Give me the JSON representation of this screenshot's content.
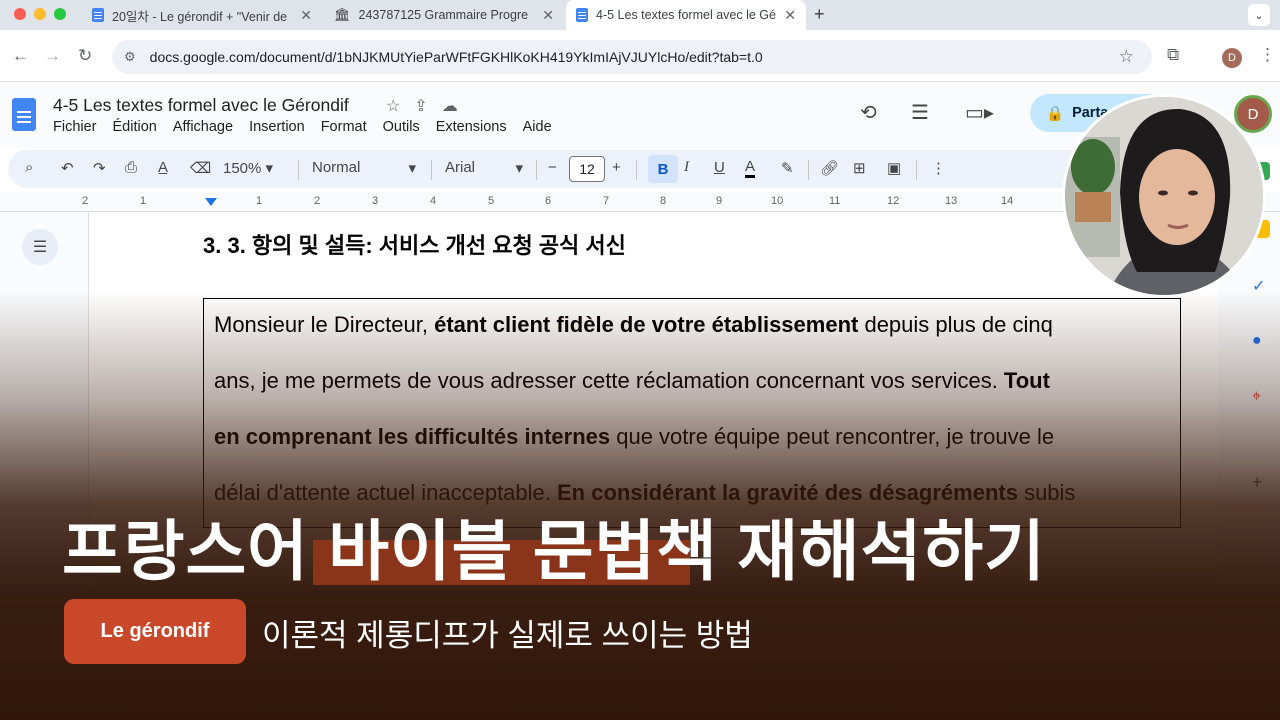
{
  "browser": {
    "tabs": [
      {
        "title": "20일차 - Le gérondif + \"Venir de",
        "icon": "google-docs-icon"
      },
      {
        "title": "243787125 Grammaire Progre",
        "icon": "bank-icon"
      },
      {
        "title": "4-5 Les textes formel avec le Gé",
        "icon": "google-docs-icon"
      }
    ],
    "new_tab": "+",
    "url": "docs.google.com/document/d/1bNJKMUtYieParWFtFGKHlKoKH419YkImIAjVJUYlcHo/edit?tab=t.0",
    "profile_initial": "D"
  },
  "docs": {
    "title": "4-5 Les textes formel avec le Gérondif",
    "menu": [
      "Fichier",
      "Édition",
      "Affichage",
      "Insertion",
      "Format",
      "Outils",
      "Extensions",
      "Aide"
    ],
    "share_label": "Parta",
    "account_initial": "D",
    "toolbar": {
      "zoom": "150%",
      "style": "Normal",
      "font": "Arial",
      "font_size": "12",
      "bold": "B",
      "italic": "I",
      "underline": "U",
      "text_color": "A"
    },
    "ruler": [
      "2",
      "1",
      "1",
      "2",
      "3",
      "4",
      "5",
      "6",
      "7",
      "8",
      "9",
      "10",
      "11",
      "12",
      "13",
      "14"
    ]
  },
  "document": {
    "heading": "3. 3. 항의 및 설득: 서비스 개선 요청 공식 서신",
    "lines": [
      [
        {
          "t": "Monsieur le Directeur, ",
          "b": false
        },
        {
          "t": "étant client fidèle de votre établissement",
          "b": true
        },
        {
          "t": " depuis plus de cinq",
          "b": false
        }
      ],
      [
        {
          "t": "ans, je me permets de vous adresser cette réclamation concernant vos services. ",
          "b": false
        },
        {
          "t": "Tout",
          "b": true
        }
      ],
      [
        {
          "t": "en comprenant les difficultés internes",
          "b": true
        },
        {
          "t": " que votre équipe peut rencontrer, je trouve le",
          "b": false
        }
      ],
      [
        {
          "t": "délai d'attente actuel inacceptable. ",
          "b": false
        },
        {
          "t": "En considérant la gravité des désagréments",
          "b": true
        },
        {
          "t": " subis",
          "b": false
        }
      ]
    ]
  },
  "overlay": {
    "title": "프랑스어 바이블 문법책 재해석하기",
    "tag": "Le gérondif",
    "subtitle": "이론적 제롱디프가 실제로 쓰이는 방법",
    "highlight_color": "#8a3519",
    "tag_color": "#c9482a"
  }
}
